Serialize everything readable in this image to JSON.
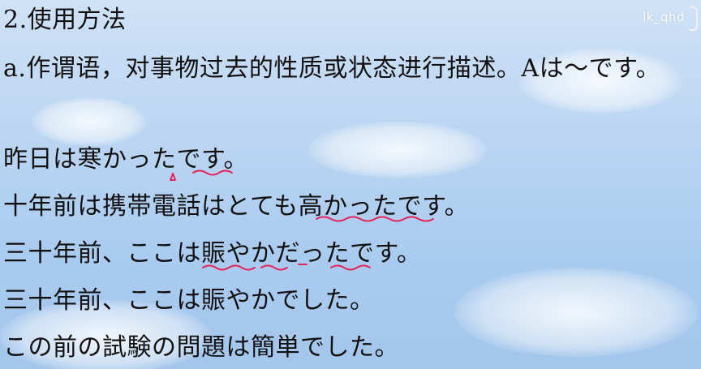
{
  "watermark": "lk_qhd",
  "heading": "2.使用方法",
  "usage": "a.作谓语，对事物过去的性质或状态进行描述。Aは～です。",
  "examples": [
    "昨日は寒かったです。",
    "十年前は携帯電話はとても高かったです。",
    "三十年前、ここは賑やかだったです。",
    "三十年前、ここは賑やかでした。",
    "この前の試験の問題は簡単でした。"
  ],
  "annotation_color": "#e4245a"
}
